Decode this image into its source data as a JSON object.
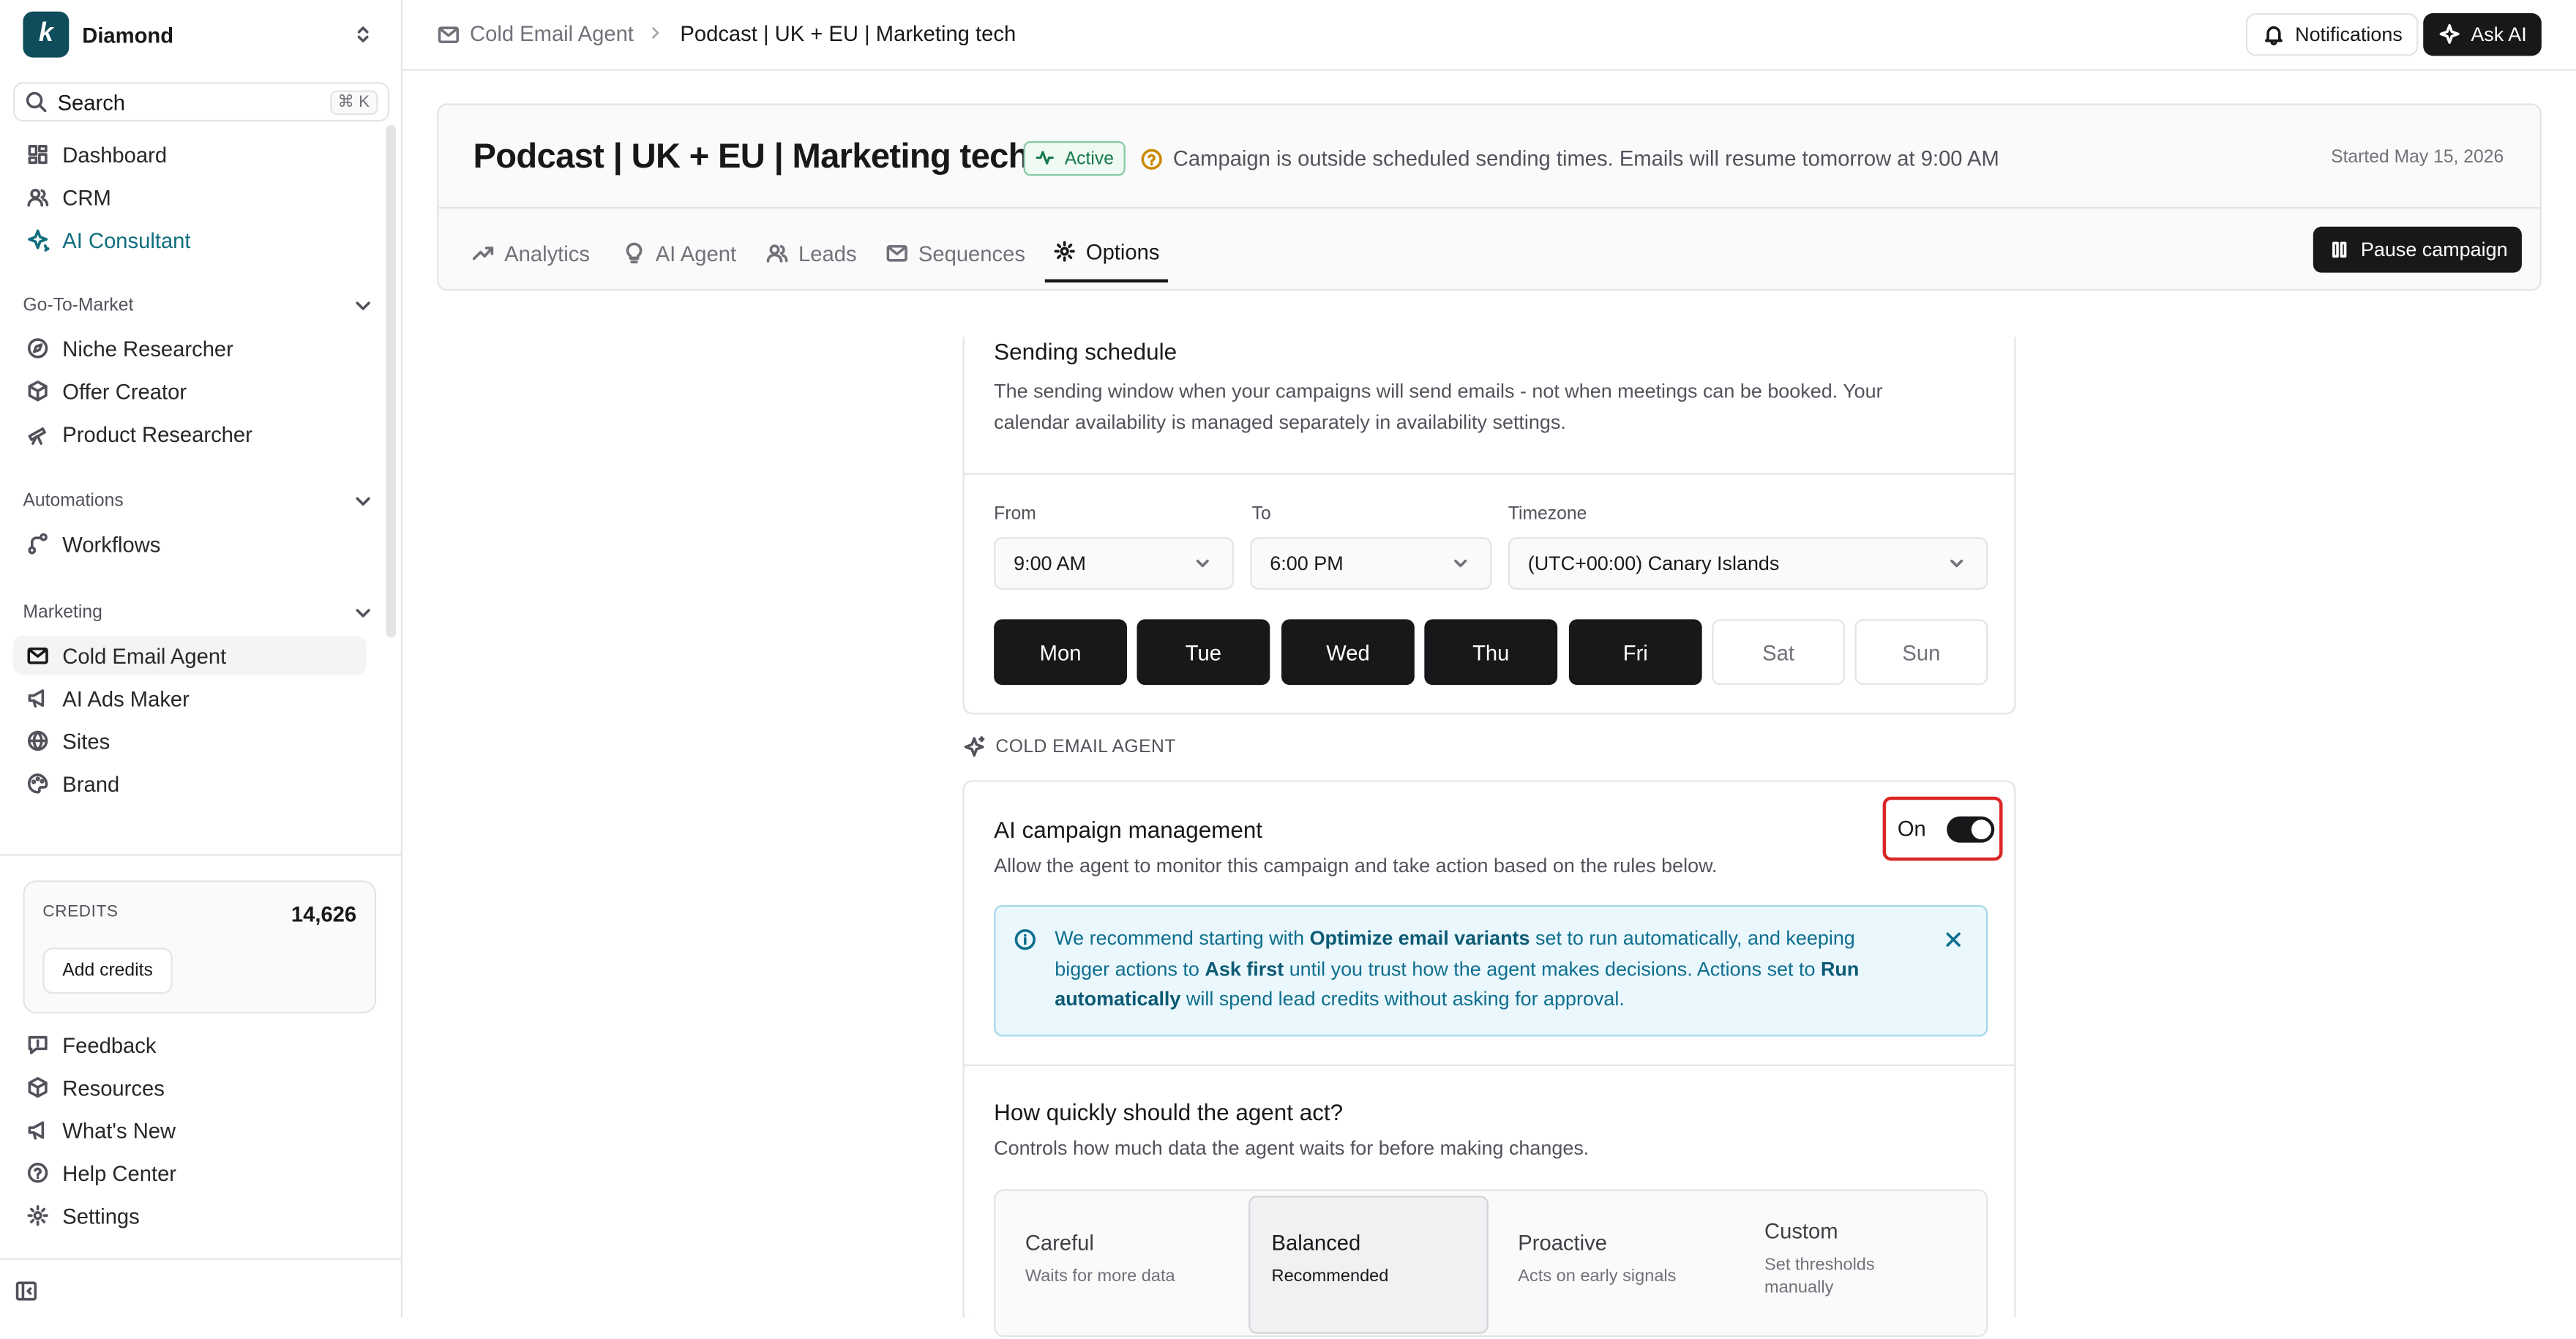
{
  "sidebar": {
    "workspace": "Diamond",
    "logo_letter": "k",
    "search_label": "Search",
    "search_shortcut": "⌘ K",
    "top_items": [
      {
        "label": "Dashboard",
        "icon": "grid-icon"
      },
      {
        "label": "CRM",
        "icon": "users-icon"
      },
      {
        "label": "AI Consultant",
        "icon": "sparkle-icon"
      }
    ],
    "sections": [
      {
        "title": "Go-To-Market",
        "items": [
          {
            "label": "Niche Researcher",
            "icon": "compass-icon"
          },
          {
            "label": "Offer Creator",
            "icon": "package-icon"
          },
          {
            "label": "Product Researcher",
            "icon": "telescope-icon"
          }
        ]
      },
      {
        "title": "Automations",
        "items": [
          {
            "label": "Workflows",
            "icon": "workflow-icon"
          }
        ]
      },
      {
        "title": "Marketing",
        "items": [
          {
            "label": "Cold Email Agent",
            "icon": "mail-icon"
          },
          {
            "label": "AI Ads Maker",
            "icon": "megaphone-icon"
          },
          {
            "label": "Sites",
            "icon": "globe-icon"
          },
          {
            "label": "Brand",
            "icon": "palette-icon"
          }
        ]
      }
    ],
    "credits": {
      "label": "CREDITS",
      "value": "14,626",
      "button": "Add credits"
    },
    "bottom_items": [
      {
        "label": "Feedback",
        "icon": "feedback-icon"
      },
      {
        "label": "Resources",
        "icon": "box-icon"
      },
      {
        "label": "What's New",
        "icon": "megaphone-icon"
      },
      {
        "label": "Help Center",
        "icon": "help-icon"
      },
      {
        "label": "Settings",
        "icon": "gear-icon"
      }
    ]
  },
  "topbar": {
    "breadcrumb_parent": "Cold Email Agent",
    "breadcrumb_current": "Podcast | UK + EU | Marketing tech",
    "notifications_label": "Notifications",
    "ask_ai_label": "Ask AI"
  },
  "campaign": {
    "title": "Podcast | UK + EU | Marketing tech",
    "status": "Active",
    "status_color": "#16794a",
    "notice": "Campaign is outside scheduled sending times. Emails will resume tomorrow at 9:00 AM",
    "started": "Started May 15, 2026",
    "tabs": [
      {
        "label": "Analytics",
        "icon": "trending-up-icon"
      },
      {
        "label": "AI Agent",
        "icon": "lightbulb-icon"
      },
      {
        "label": "Leads",
        "icon": "users-icon"
      },
      {
        "label": "Sequences",
        "icon": "mail-icon"
      },
      {
        "label": "Options",
        "icon": "gear-icon"
      }
    ],
    "active_tab": "Options",
    "pause_label": "Pause campaign"
  },
  "schedule": {
    "title": "Sending schedule",
    "description": "The sending window when your campaigns will send emails - not when meetings can be booked. Your calendar availability is managed separately in availability settings.",
    "from_label": "From",
    "from_value": "9:00 AM",
    "to_label": "To",
    "to_value": "6:00 PM",
    "timezone_label": "Timezone",
    "timezone_value": "(UTC+00:00) Canary Islands",
    "days": [
      {
        "label": "Mon",
        "active": true
      },
      {
        "label": "Tue",
        "active": true
      },
      {
        "label": "Wed",
        "active": true
      },
      {
        "label": "Thu",
        "active": true
      },
      {
        "label": "Fri",
        "active": true
      },
      {
        "label": "Sat",
        "active": false
      },
      {
        "label": "Sun",
        "active": false
      }
    ]
  },
  "agent_section_label": "COLD EMAIL AGENT",
  "ai_management": {
    "title": "AI campaign management",
    "description": "Allow the agent to monitor this campaign and take action based on the rules below.",
    "toggle_label": "On",
    "toggle_on": true,
    "info": {
      "t1": "We recommend starting with ",
      "b1": "Optimize email variants",
      "t2": " set to run automatically, and keeping bigger actions to ",
      "b2": "Ask first",
      "t3": " until you trust how the agent makes decisions. Actions set to ",
      "b3": "Run automatically",
      "t4": " will spend lead credits without asking for approval."
    },
    "speed_title": "How quickly should the agent act?",
    "speed_description": "Controls how much data the agent waits for before making changes.",
    "speed_options": [
      {
        "title": "Careful",
        "sub": "Waits for more data"
      },
      {
        "title": "Balanced",
        "sub": "Recommended"
      },
      {
        "title": "Proactive",
        "sub": "Acts on early signals"
      },
      {
        "title": "Custom",
        "sub": "Set thresholds manually"
      }
    ],
    "speed_selected": "Balanced"
  }
}
